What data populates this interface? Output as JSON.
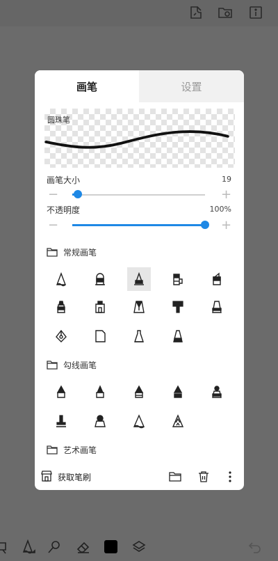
{
  "toolbar_top": {
    "icons": [
      "brush-library-icon",
      "gallery-icon",
      "info-icon"
    ]
  },
  "panel": {
    "tabs": [
      {
        "label": "画笔",
        "active": true
      },
      {
        "label": "设置",
        "active": false
      }
    ],
    "preview": {
      "brush_name": "圆珠笔"
    },
    "size": {
      "label": "画笔大小",
      "value": "19",
      "fraction": 0.03
    },
    "opacity": {
      "label": "不透明度",
      "value": "100%",
      "fraction": 1.0
    },
    "sections": [
      {
        "title": "常规画笔"
      },
      {
        "title": "勾线画笔"
      },
      {
        "title": "艺术画笔"
      }
    ],
    "footer": {
      "get_brushes_label": "获取笔刷"
    }
  },
  "toolbar_bottom": {
    "icons": [
      "selection-icon",
      "brush-tool-icon",
      "smudge-icon",
      "eraser-icon",
      "color-swatch-icon",
      "layers-icon",
      "undo-icon",
      "redo-icon"
    ],
    "color": "#000000"
  },
  "accent_color": "#1e88e5"
}
